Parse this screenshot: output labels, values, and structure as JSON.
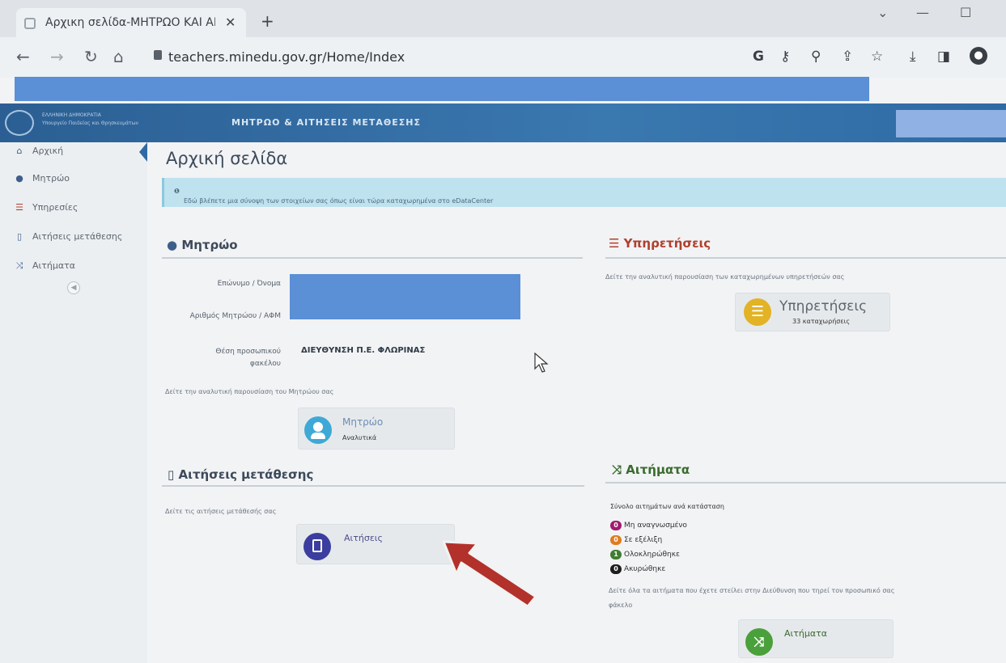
{
  "browser": {
    "tab_title": "Αρχικη σελίδα-ΜΗΤΡΩΟ ΚΑΙ ΑΙ",
    "tab_close": "✕",
    "new_tab": "+",
    "url": "teachers.minedu.gov.gr/Home/Index",
    "minimize": "—",
    "maximize": "☐",
    "chevron": "⌄"
  },
  "header": {
    "ministry_line1": "ΕΛΛΗΝΙΚΗ ΔΗΜΟΚΡΑΤΙΑ",
    "ministry_line2": "Υπουργείο Παιδείας και Θρησκευμάτων",
    "app_title": "ΜΗΤΡΩΟ & ΑΙΤΗΣΕΙΣ ΜΕΤΑΘΕΣΗΣ"
  },
  "sidebar": {
    "items": [
      {
        "label": "Αρχική",
        "icon": "home-icon"
      },
      {
        "label": "Μητρώο",
        "icon": "user-icon"
      },
      {
        "label": "Υπηρεσίες",
        "icon": "list-icon"
      },
      {
        "label": "Αιτήσεις μετάθεσης",
        "icon": "file-icon"
      },
      {
        "label": "Αιτήματα",
        "icon": "shuffle-icon"
      }
    ]
  },
  "main": {
    "page_title": "Αρχική σελίδα",
    "info": "Εδώ βλέπετε μια σύνοψη των στοιχείων σας όπως είναι τώρα καταχωρημένα στο eDataCenter",
    "mitroo": {
      "heading": "Μητρώο",
      "label_name": "Επώνυμο / Όνομα",
      "label_afm": "Αριθμός Μητρώου / ΑΦΜ",
      "label_thesi_1": "Θέση προσωπικού",
      "label_thesi_2": "φακέλου",
      "thesi_value": "ΔΙΕΥΘΥΝΣΗ Π.Ε. ΦΛΩΡΙΝΑΣ",
      "desc": "Δείτε την αναλυτική παρουσίαση του Μητρώου σας",
      "tile_title": "Μητρώο",
      "tile_sub": "Αναλυτικά"
    },
    "ypiresies": {
      "heading": "Υπηρετήσεις",
      "desc": "Δείτε την αναλυτική παρουσίαση των καταχωρημένων υπηρετήσεών σας",
      "tile_title": "Υπηρετήσεις",
      "tile_sub": "33 καταχωρήσεις"
    },
    "aitiseis": {
      "heading": "Αιτήσεις μετάθεσης",
      "desc": "Δείτε τις αιτήσεις μετάθεσής σας",
      "tile_title": "Αιτήσεις"
    },
    "aitimata": {
      "heading": "Αιτήματα",
      "desc": "Σύνολο αιτημάτων ανά κατάσταση",
      "statuses": [
        {
          "count": "0",
          "label": "Μη αναγνωσμένο",
          "color": "#a3196e"
        },
        {
          "count": "0",
          "label": "Σε εξέλιξη",
          "color": "#e07b1f"
        },
        {
          "count": "1",
          "label": "Ολοκληρώθηκε",
          "color": "#3f7d32"
        },
        {
          "count": "0",
          "label": "Ακυρώθηκε",
          "color": "#1d1d1d"
        }
      ],
      "desc2_line1": "Δείτε όλα τα αιτήματα που έχετε στείλει στην Διεύθυνση που τηρεί τον προσωπικό σας",
      "desc2_line2": "φάκελο",
      "tile_title": "Αιτήματα"
    }
  },
  "colors": {
    "header_blue": "#2f6aa4",
    "mitroo_circle": "#3ea9d6",
    "ypiresies_circle": "#e2b325",
    "aitiseis_circle": "#3b3e9e",
    "aitimata_circle": "#4aa03a",
    "ypiresies_heading": "#b0402e",
    "aitimata_heading": "#3a6b2f",
    "arrow": "#b3312b"
  }
}
